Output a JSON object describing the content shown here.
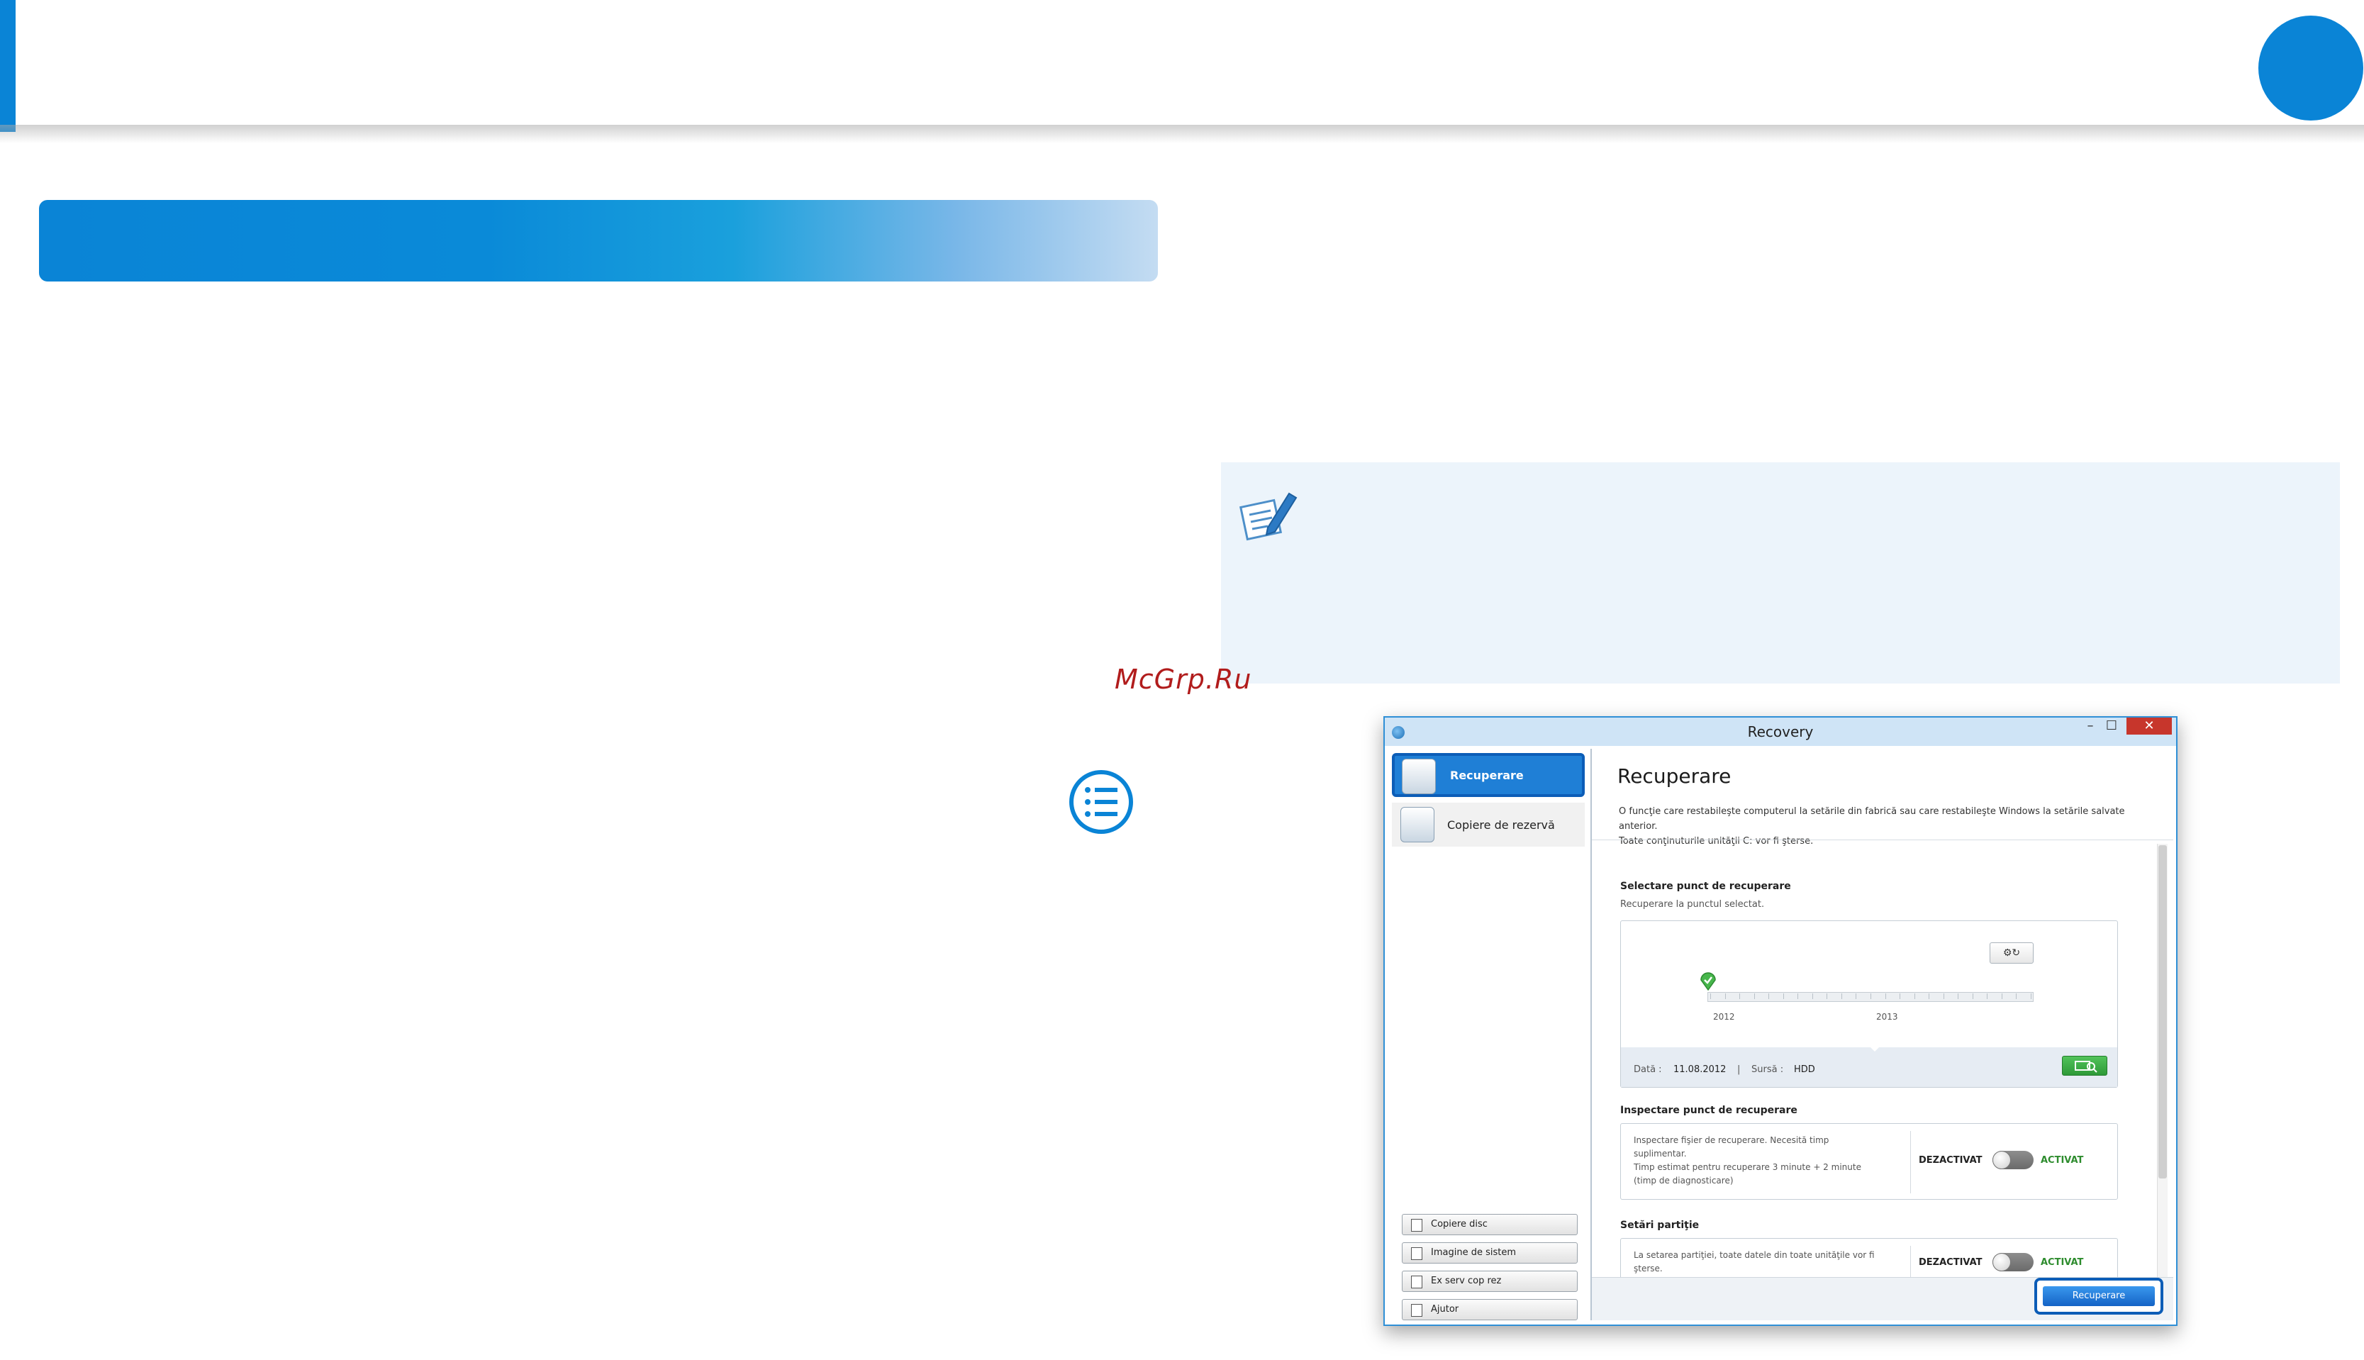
{
  "watermark": "McGrp.Ru",
  "window": {
    "title": "Recovery",
    "minimize_glyph": "–",
    "maximize_glyph": "☐",
    "close_glyph": "✕"
  },
  "sidebar": {
    "items": [
      {
        "label": "Recuperare",
        "icon": "recovery-drive-icon",
        "selected": true
      },
      {
        "label": "Copiere de rezervă",
        "icon": "backup-drive-icon",
        "selected": false
      }
    ],
    "buttons": [
      {
        "label": "Copiere disc",
        "icon": "copy-disc-icon"
      },
      {
        "label": "Imagine de sistem",
        "icon": "system-image-icon"
      },
      {
        "label": "Ex serv cop rez",
        "icon": "export-backup-icon"
      },
      {
        "label": "Ajutor",
        "icon": "help-icon"
      }
    ]
  },
  "main": {
    "title": "Recuperare",
    "description_line1": "O funcţie care restabileşte computerul la setările din fabrică sau care restabileşte Windows la setările salvate anterior.",
    "description_line2": "Toate conţinuturile unităţii C: vor fi şterse.",
    "restore_point": {
      "heading": "Selectare punct de recuperare",
      "subheading": "Recuperare la punctul selectat.",
      "years": [
        "2012",
        "2013"
      ],
      "date_label": "Dată :",
      "date_value": "11.08.2012",
      "separator": "|",
      "source_label": "Sursă :",
      "source_value": "HDD"
    },
    "inspect": {
      "heading": "Inspectare punct de recuperare",
      "text_line1": "Inspectare fişier de recuperare. Necesită timp",
      "text_line2": "suplimentar.",
      "text_line3": "Timp estimat pentru recuperare 3 minute + 2 minute",
      "text_line4": "(timp de diagnosticare)",
      "off_label": "DEZACTIVAT",
      "on_label": "ACTIVAT",
      "enabled": false
    },
    "partition": {
      "heading": "Setări partiţie",
      "text_line1": "La setarea partiţiei, toate datele din toate unităţile vor fi",
      "text_line2": "şterse.",
      "off_label": "DEZACTIVAT",
      "on_label": "ACTIVAT",
      "enabled": false
    },
    "action_button": "Recuperare"
  },
  "colors": {
    "accent": "#0a84d6",
    "highlight_frame": "#0c5db7",
    "active_green": "#2e8c2e",
    "close_red": "#c7362c"
  }
}
